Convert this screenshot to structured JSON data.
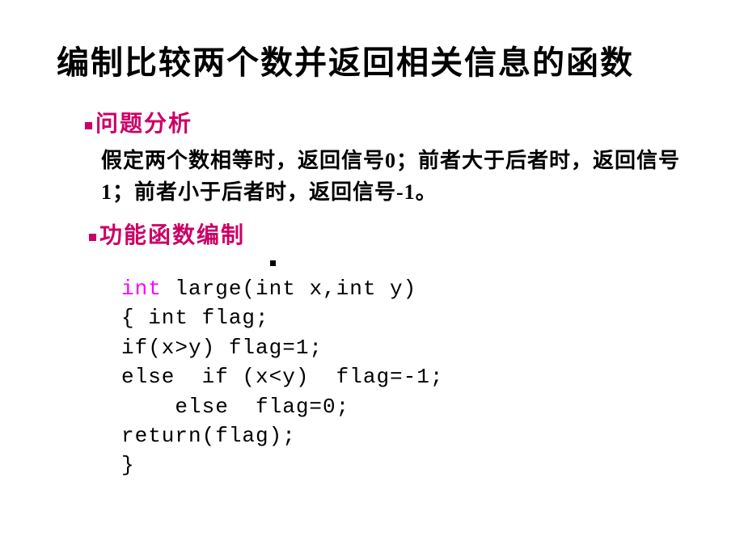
{
  "title": "编制比较两个数并返回相关信息的函数",
  "section1": {
    "header": "问题分析",
    "text": "假定两个数相等时，返回信号0；前者大于后者时，返回信号1；前者小于后者时，返回信号-1。"
  },
  "section2": {
    "header": "功能函数编制"
  },
  "code": {
    "line1_keyword": "int",
    "line1_rest": " large(int x,int y)",
    "line2": "{ int flag;",
    "line3": "if(x>y) flag=1;",
    "line4": "else  if (x<y)  flag=-1;",
    "line5": "    else  flag=0;",
    "line6": "return(flag);",
    "line7": "}"
  }
}
